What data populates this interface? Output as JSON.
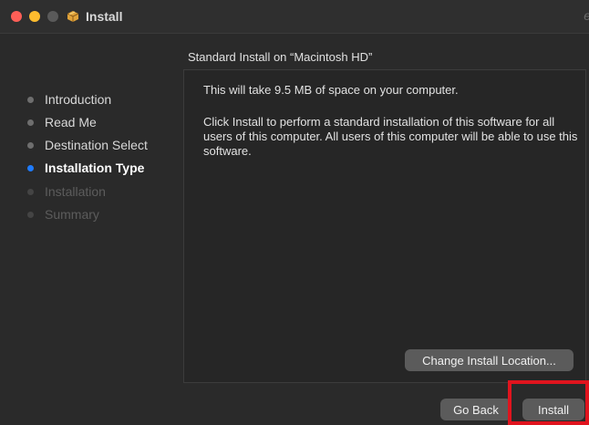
{
  "window": {
    "title": "Install",
    "title_right_fragment": "e"
  },
  "sidebar": {
    "steps": [
      {
        "label": "Introduction",
        "state": "done"
      },
      {
        "label": "Read Me",
        "state": "done"
      },
      {
        "label": "Destination Select",
        "state": "done"
      },
      {
        "label": "Installation Type",
        "state": "active"
      },
      {
        "label": "Installation",
        "state": "future"
      },
      {
        "label": "Summary",
        "state": "future"
      }
    ]
  },
  "main": {
    "heading": "Standard Install on “Macintosh HD”",
    "space_text": "This will take 9.5 MB of space on your computer.",
    "description": "Click Install to perform a standard installation of this software for all users of this computer. All users of this computer will be able to use this software."
  },
  "buttons": {
    "change_location": "Change Install Location...",
    "go_back": "Go Back",
    "install": "Install"
  },
  "colors": {
    "accent": "#1f7cff",
    "highlight_box": "#e0141e"
  }
}
